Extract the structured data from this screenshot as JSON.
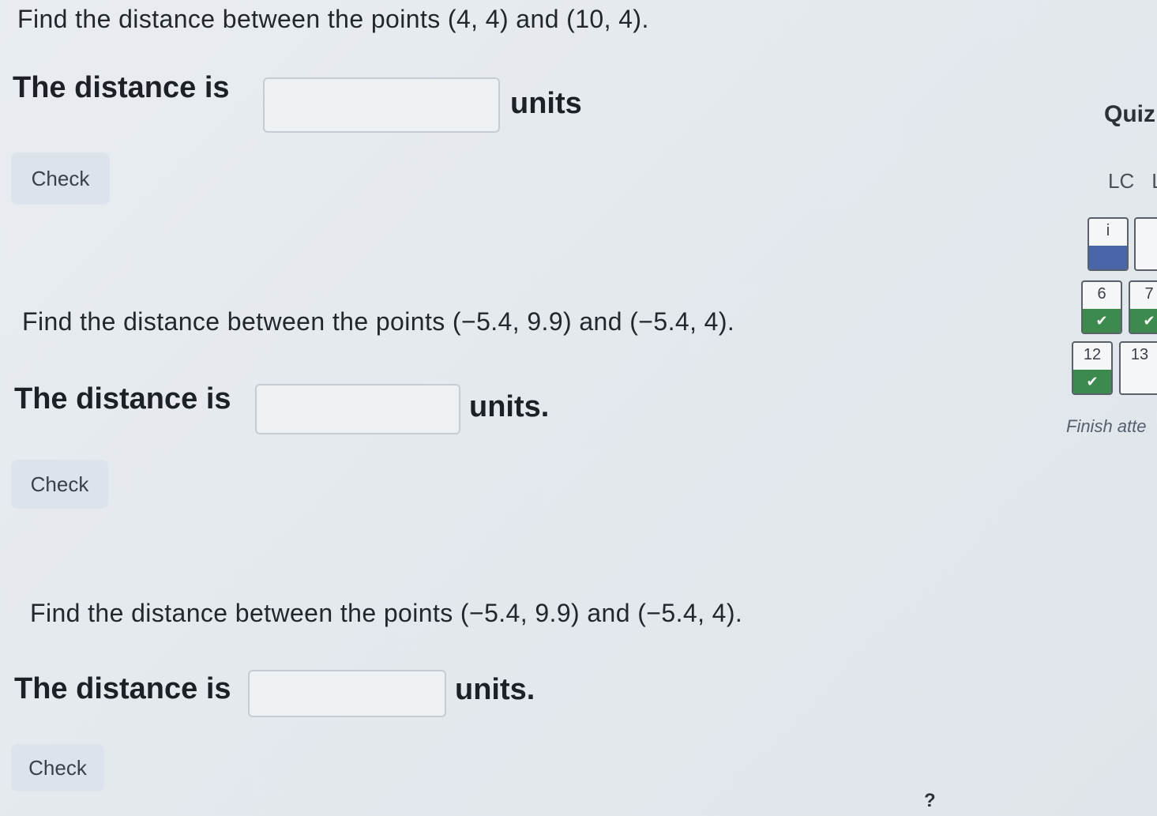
{
  "questions": [
    {
      "prompt": "Find the distance between the points (4, 4) and (10, 4).",
      "answer_prefix": "The distance is",
      "answer_value": "",
      "answer_suffix": "units",
      "check_label": "Check"
    },
    {
      "prompt": "Find the distance between the points (−5.4, 9.9) and (−5.4, 4).",
      "answer_prefix": "The distance is",
      "answer_value": "",
      "answer_suffix": "units.",
      "check_label": "Check"
    },
    {
      "prompt": "Find the distance between the points (−5.4, 9.9) and (−5.4, 4).",
      "answer_prefix": "The distance is",
      "answer_value": "",
      "answer_suffix": "units.",
      "check_label": "Check"
    }
  ],
  "quiz_nav": {
    "title": "Quiz",
    "header_items": [
      "LC",
      "L"
    ],
    "buttons": [
      {
        "label": "i",
        "status": "current"
      },
      {
        "label": "",
        "status": "unanswered"
      },
      {
        "label": "6",
        "status": "correct"
      },
      {
        "label": "7",
        "status": "correct"
      },
      {
        "label": "12",
        "status": "correct"
      },
      {
        "label": "13",
        "status": "unanswered"
      }
    ],
    "finish_label": "Finish atte"
  },
  "help_label": "?",
  "icons": {
    "correct": "check-mark-icon"
  },
  "colors": {
    "correct": "#3d8a4f",
    "current": "#4a66a8",
    "background": "#e6ebef"
  }
}
